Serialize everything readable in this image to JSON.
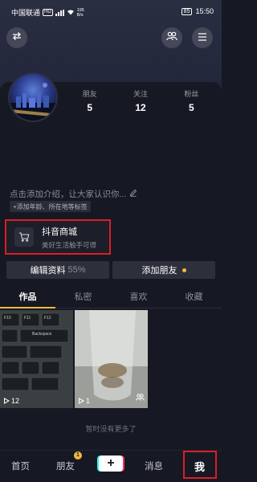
{
  "status_bar": {
    "carrier": "中国联通",
    "network_badge": "HD",
    "speed_value": "195",
    "speed_unit": "B/s",
    "battery": "85",
    "time": "15:50"
  },
  "header": {
    "left_icon": "switch-account-icon",
    "right_icon": "friends-icon"
  },
  "profile": {
    "stats": [
      {
        "label": "朋友",
        "value": "5"
      },
      {
        "label": "关注",
        "value": "12"
      },
      {
        "label": "粉丝",
        "value": "5"
      }
    ],
    "intro_placeholder": "点击添加介绍，让大家认识你...",
    "tag_chip": "+添加年龄、所在地等标签"
  },
  "shop": {
    "title": "抖音商城",
    "subtitle": "美好生活触手可得"
  },
  "actions": {
    "edit_label": "编辑资料",
    "edit_percent": "55%",
    "add_friend_label": "添加朋友"
  },
  "tabs": [
    {
      "label": "作品",
      "active": true
    },
    {
      "label": "私密",
      "active": false
    },
    {
      "label": "喜欢",
      "active": false
    },
    {
      "label": "收藏",
      "active": false
    }
  ],
  "videos": [
    {
      "plays": "12",
      "keyboard_keys": [
        "F10",
        "F11",
        "F12",
        "Backspace"
      ]
    },
    {
      "plays": "1"
    }
  ],
  "no_more_text": "暂时没有更多了",
  "bottom_nav": {
    "home": "首页",
    "friends": "朋友",
    "friends_badge": "1",
    "messages": "消息",
    "me": "我"
  },
  "colors": {
    "background": "#161823",
    "accent_yellow": "#f6b938",
    "highlight_red": "#d91f26"
  }
}
